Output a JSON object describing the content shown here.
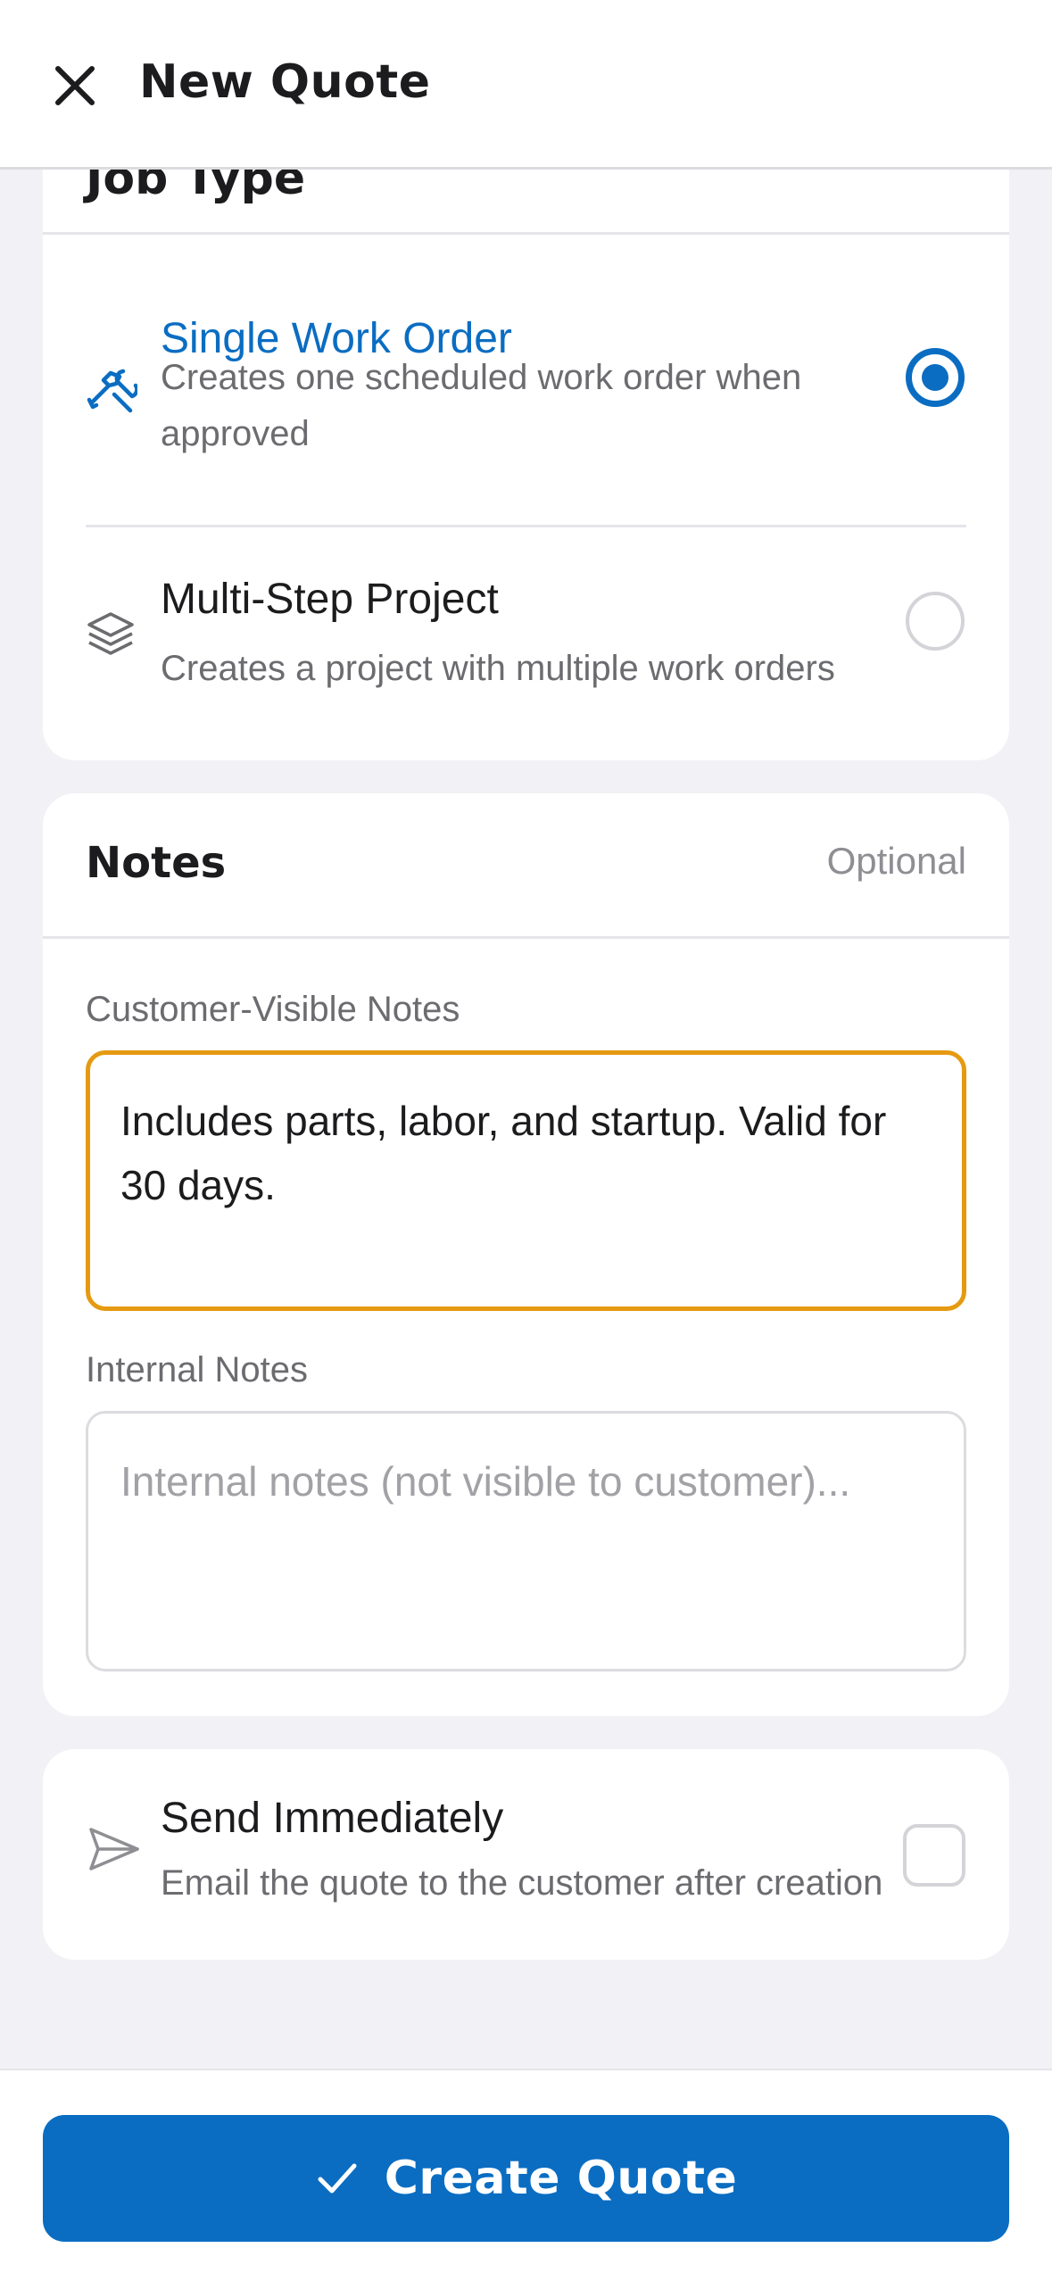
{
  "header": {
    "title": "New Quote",
    "close_icon": "close-icon"
  },
  "job_type": {
    "section_title": "Job Type",
    "options": [
      {
        "title": "Single Work Order",
        "description": "Creates one scheduled work order when approved",
        "icon": "tools-icon",
        "selected": true
      },
      {
        "title": "Multi-Step Project",
        "description": "Creates a project with multiple work orders",
        "icon": "layers-icon",
        "selected": false
      }
    ]
  },
  "notes": {
    "title": "Notes",
    "optional_label": "Optional",
    "customer_visible": {
      "label": "Customer-Visible Notes",
      "value": "Includes parts, labor, and startup. Valid for 30 days."
    },
    "internal": {
      "label": "Internal Notes",
      "placeholder": "Internal notes (not visible to customer)..."
    }
  },
  "send_immediately": {
    "title": "Send Immediately",
    "description": "Email the quote to the customer after creation",
    "icon": "send-icon",
    "checked": false
  },
  "actions": {
    "create_label": "Create Quote",
    "create_icon": "checkmark-icon"
  },
  "colors": {
    "accent": "#0a6dc2",
    "focus_border": "#e59a11",
    "background": "#f2f2f6"
  }
}
